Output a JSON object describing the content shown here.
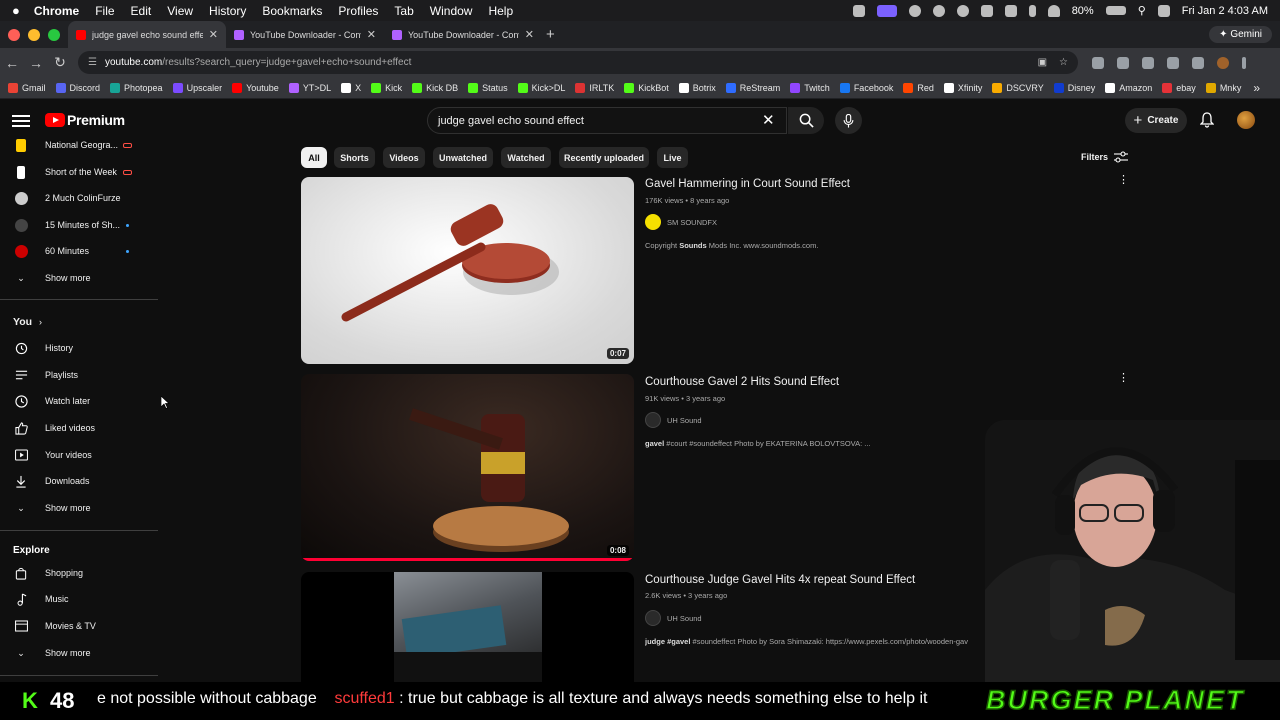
{
  "menubar": {
    "apple": "",
    "app": "Chrome",
    "items": [
      "File",
      "Edit",
      "View",
      "History",
      "Bookmarks",
      "Profiles",
      "Tab",
      "Window",
      "Help"
    ],
    "battery": "80%",
    "clock": "Fri Jan 2  4:03 AM"
  },
  "tabs": [
    {
      "title": "judge gavel echo sound effec",
      "color": "#ff0000"
    },
    {
      "title": "YouTube Downloader - Conve",
      "color": "#b061ff"
    },
    {
      "title": "YouTube Downloader - Conve",
      "color": "#b061ff"
    }
  ],
  "gemini_label": "Gemini",
  "address": {
    "domain": "youtube.com",
    "path": "/results?search_query=judge+gavel+echo+sound+effect"
  },
  "bookmarks": [
    {
      "label": "Gmail",
      "color": "#ea4335"
    },
    {
      "label": "Discord",
      "color": "#5865f2"
    },
    {
      "label": "Photopea",
      "color": "#18a497"
    },
    {
      "label": "Upscaler",
      "color": "#7b4bff"
    },
    {
      "label": "Youtube",
      "color": "#ff0000"
    },
    {
      "label": "YT>DL",
      "color": "#b061ff"
    },
    {
      "label": "X",
      "color": "#ffffff"
    },
    {
      "label": "Kick",
      "color": "#53fc18"
    },
    {
      "label": "Kick DB",
      "color": "#53fc18"
    },
    {
      "label": "Status",
      "color": "#53fc18"
    },
    {
      "label": "Kick>DL",
      "color": "#53fc18"
    },
    {
      "label": "IRLTK",
      "color": "#d33"
    },
    {
      "label": "KickBot",
      "color": "#53fc18"
    },
    {
      "label": "Botrix",
      "color": "#ffffff"
    },
    {
      "label": "ReStream",
      "color": "#2f6cff"
    },
    {
      "label": "Twitch",
      "color": "#9146ff"
    },
    {
      "label": "Facebook",
      "color": "#1877f2"
    },
    {
      "label": "Red",
      "color": "#ff4500"
    },
    {
      "label": "Xfinity",
      "color": "#ffffff"
    },
    {
      "label": "DSCVRY",
      "color": "#f9ab00"
    },
    {
      "label": "Disney",
      "color": "#113ccf"
    },
    {
      "label": "Amazon",
      "color": "#ffffff"
    },
    {
      "label": "ebay",
      "color": "#e53238"
    },
    {
      "label": "Mnky",
      "color": "#e0a800"
    }
  ],
  "youtube": {
    "logo": "Premium",
    "search_value": "judge gavel echo sound effect",
    "create_label": "Create"
  },
  "sidebar": {
    "subscriptions": [
      {
        "label": "National Geogra...",
        "indicator": "live",
        "avatar": "#ffcc00"
      },
      {
        "label": "Short of the Week",
        "indicator": "live",
        "avatar": "#ffffff"
      },
      {
        "label": "2 Much ColinFurze",
        "indicator": "",
        "avatar": "#cccccc"
      },
      {
        "label": "15 Minutes of Sh...",
        "indicator": "dot",
        "avatar": "#444444"
      },
      {
        "label": "60 Minutes",
        "indicator": "dot",
        "avatar": "#cc0000"
      }
    ],
    "show_more_1": "Show more",
    "you_title": "You",
    "you_items": [
      "History",
      "Playlists",
      "Watch later",
      "Liked videos",
      "Your videos",
      "Downloads"
    ],
    "show_more_2": "Show more",
    "explore_title": "Explore",
    "explore_items": [
      "Shopping",
      "Music",
      "Movies & TV"
    ],
    "show_more_3": "Show more"
  },
  "chips": [
    "All",
    "Shorts",
    "Videos",
    "Unwatched",
    "Watched",
    "Recently uploaded",
    "Live"
  ],
  "filters_label": "Filters",
  "results": [
    {
      "title": "Gavel Hammering in Court Sound Effect",
      "meta": "176K views • 8 years ago",
      "channel": "SM SOUNDFX",
      "channel_color": "#f5e000",
      "desc_bold": "Sounds",
      "desc_pre": "Copyright ",
      "desc_post": " Mods Inc. www.soundmods.com.",
      "duration": "0:07",
      "watched": 0
    },
    {
      "title": "Courthouse Gavel 2 Hits Sound Effect",
      "meta": "91K views • 3 years ago",
      "channel": "UH Sound",
      "channel_color": "#333333",
      "desc_bold": "gavel",
      "desc_pre": "",
      "desc_post": " #court #soundeffect Photo by EKATERINA BOLOVTSOVA: ...",
      "duration": "0:08",
      "watched": 1
    },
    {
      "title": "Courthouse Judge Gavel Hits 4x repeat Sound Effect",
      "meta": "2.6K views • 3 years ago",
      "channel": "UH Sound",
      "channel_color": "#333333",
      "desc_bold": "judge #gavel",
      "desc_pre": "",
      "desc_post": " #soundeffect Photo by Sora Shimazaki: https://www.pexels.com/photo/wooden-gav",
      "duration": "",
      "watched": 0
    }
  ],
  "ticker": {
    "kick_count": "48",
    "text_pre": "e not possible without cabbage",
    "user": "scuffed1",
    "text_post": ": true but cabbage is all texture and always needs something else to help it",
    "brand": "BURGER PLANET"
  }
}
